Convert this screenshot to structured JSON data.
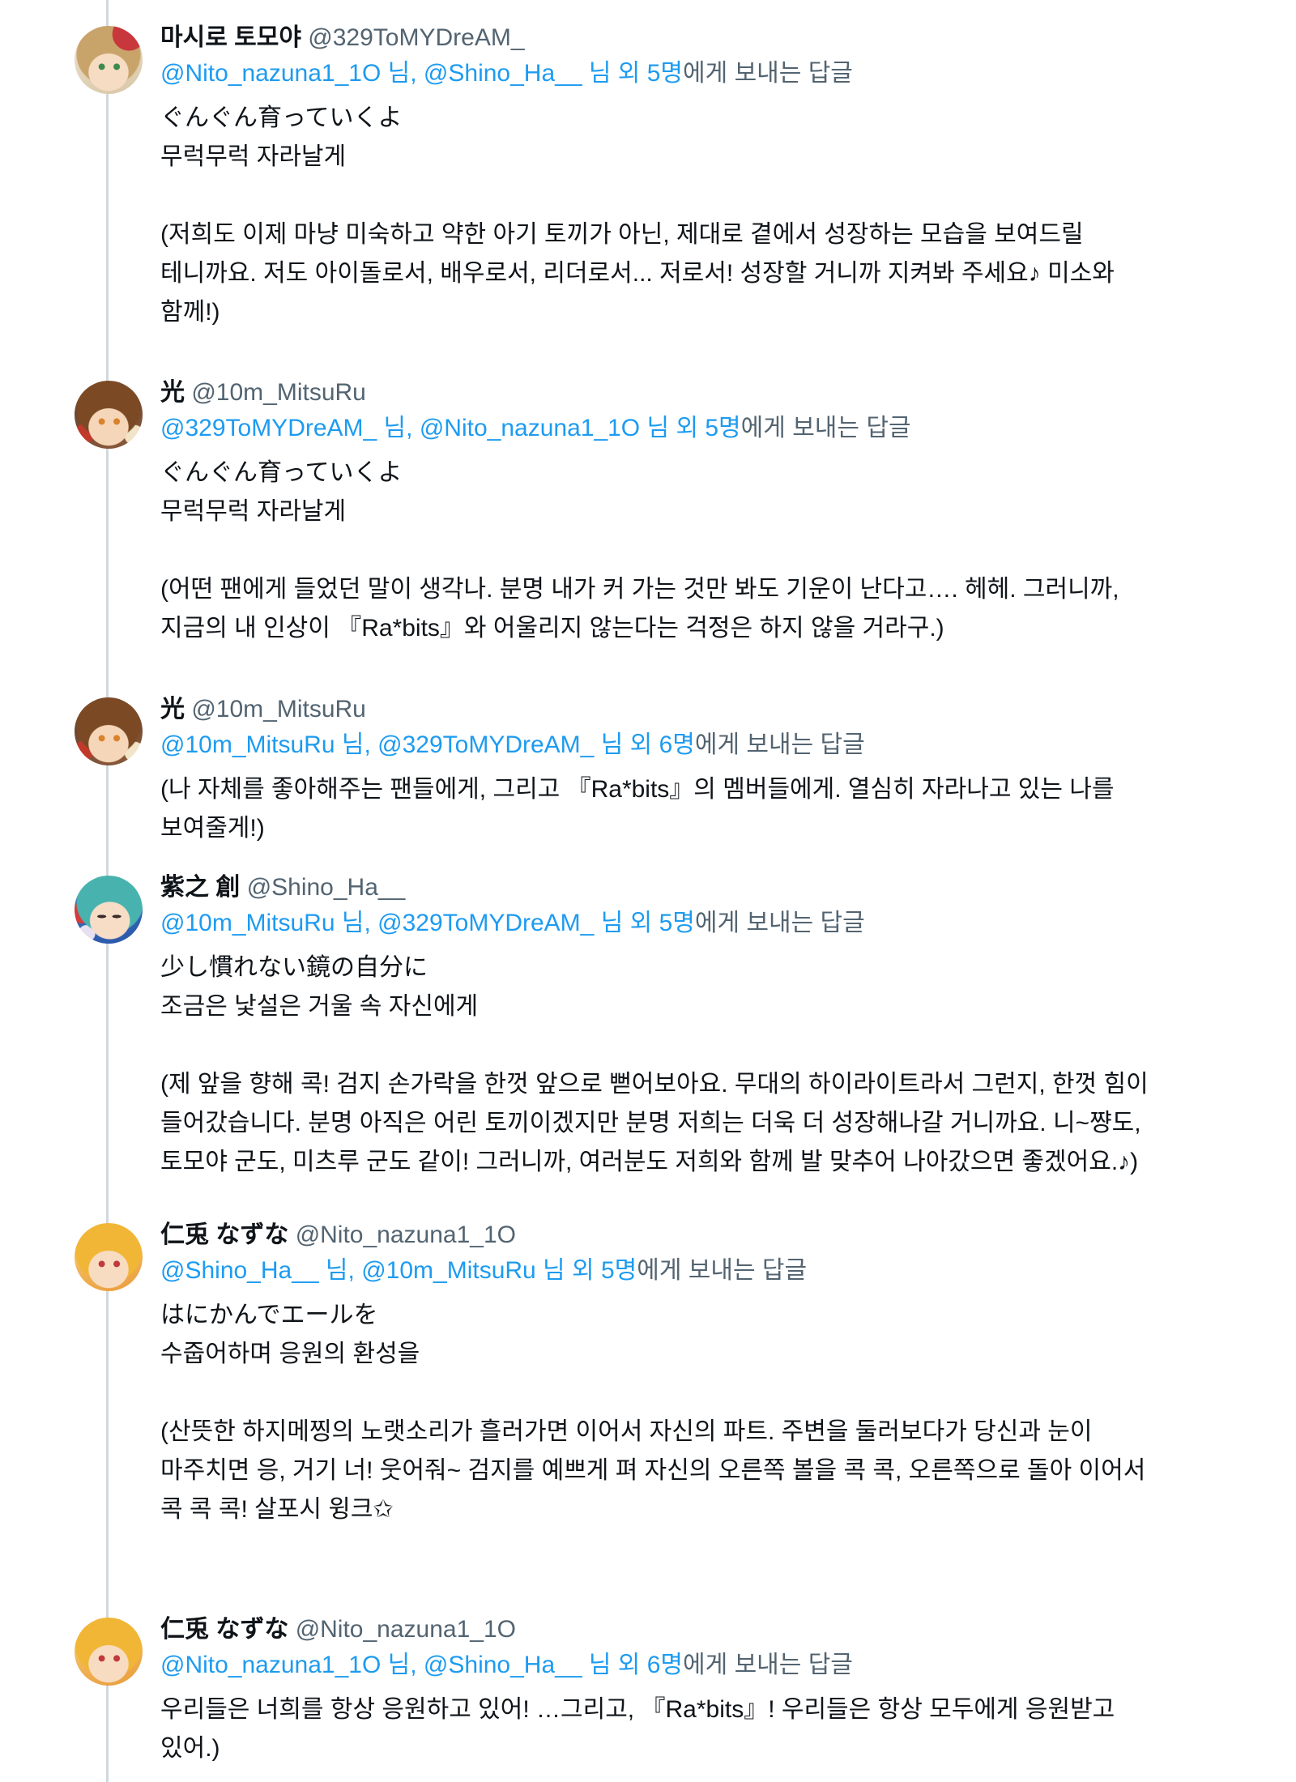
{
  "colors": {
    "text": "#0f1419",
    "muted": "#536471",
    "link": "#1d9bf0",
    "thread_line": "#cfd9de"
  },
  "tweets": [
    {
      "name": "마시로 토모야",
      "handle": "@329ToMYDreAM_",
      "reply": {
        "mention_1": "@Nito_nazuna1_1O 님,",
        "mention_2": "@Shino_Ha__ 님",
        "others": "외 5명",
        "suffix": "에게 보내는 답글"
      },
      "text": [
        [
          "ぐんぐん育っていくよ",
          "무럭무럭 자라날게"
        ],
        [
          "(저희도 이제 마냥 미숙하고 약한 아기 토끼가 아닌, 제대로 곁에서 성장하는 모습을 보여드릴",
          "테니까요. 저도 아이돌로서, 배우로서, 리더로서... 저로서! 성장할 거니까 지켜봐 주세요♪ 미소와",
          "함께!)"
        ]
      ]
    },
    {
      "name": "光",
      "handle": "@10m_MitsuRu",
      "reply": {
        "mention_1": "@329ToMYDreAM_ 님,",
        "mention_2": "@Nito_nazuna1_1O 님",
        "others": "외 5명",
        "suffix": "에게 보내는 답글"
      },
      "text": [
        [
          "ぐんぐん育っていくよ",
          "무럭무럭 자라날게"
        ],
        [
          "(어떤 팬에게 들었던 말이 생각나. 분명 내가 커 가는 것만 봐도 기운이 난다고…. 헤헤. 그러니까,",
          "지금의 내 인상이 『Ra*bits』와 어울리지 않는다는 걱정은 하지 않을 거라구.)"
        ]
      ]
    },
    {
      "name": "光",
      "handle": "@10m_MitsuRu",
      "reply": {
        "mention_1": "@10m_MitsuRu 님,",
        "mention_2": "@329ToMYDreAM_ 님",
        "others": "외 6명",
        "suffix": "에게 보내는 답글"
      },
      "text": [
        [
          "(나 자체를 좋아해주는 팬들에게, 그리고 『Ra*bits』의 멤버들에게. 열심히 자라나고 있는 나를",
          "보여줄게!)"
        ]
      ]
    },
    {
      "name": "紫之 創",
      "handle": "@Shino_Ha__",
      "reply": {
        "mention_1": "@10m_MitsuRu 님,",
        "mention_2": "@329ToMYDreAM_ 님",
        "others": "외 5명",
        "suffix": "에게 보내는 답글"
      },
      "text": [
        [
          "少し慣れない鏡の自分に",
          "조금은 낯설은 거울 속 자신에게"
        ],
        [
          "(제 앞을 향해 콕! 검지 손가락을 한껏 앞으로 뻗어보아요. 무대의 하이라이트라서 그런지, 한껏 힘이",
          "들어갔습니다. 분명 아직은 어린 토끼이겠지만 분명 저희는 더욱 더 성장해나갈 거니까요. 니~쨩도,",
          "토모야 군도, 미츠루 군도 같이! 그러니까, 여러분도 저희와 함께 발 맞추어 나아갔으면 좋겠어요.♪)"
        ]
      ]
    },
    {
      "name": "仁兎 なずな",
      "handle": "@Nito_nazuna1_1O",
      "reply": {
        "mention_1": "@Shino_Ha__ 님,",
        "mention_2": "@10m_MitsuRu 님",
        "others": "외 5명",
        "suffix": "에게 보내는 답글"
      },
      "text": [
        [
          "はにかんでエールを",
          "수줍어하며 응원의 환성을"
        ],
        [
          "(산뜻한 하지메찡의 노랫소리가 흘러가면 이어서 자신의 파트. 주변을 둘러보다가 당신과 눈이",
          "마주치면 응, 거기 너! 웃어줘~ 검지를 예쁘게 펴 자신의 오른쪽 볼을 콕 콕, 오른쪽으로 돌아 이어서",
          "콕 콕 콕! 살포시 윙크✩"
        ]
      ]
    },
    {
      "name": "仁兎 なずな",
      "handle": "@Nito_nazuna1_1O",
      "reply": {
        "mention_1": "@Nito_nazuna1_1O 님,",
        "mention_2": "@Shino_Ha__ 님",
        "others": "외 6명",
        "suffix": "에게 보내는 답글"
      },
      "text": [
        [
          "우리들은 너희를 항상 응원하고 있어! …그리고, 『Ra*bits』! 우리들은 항상 모두에게 응원받고",
          "있어.)"
        ]
      ]
    }
  ]
}
